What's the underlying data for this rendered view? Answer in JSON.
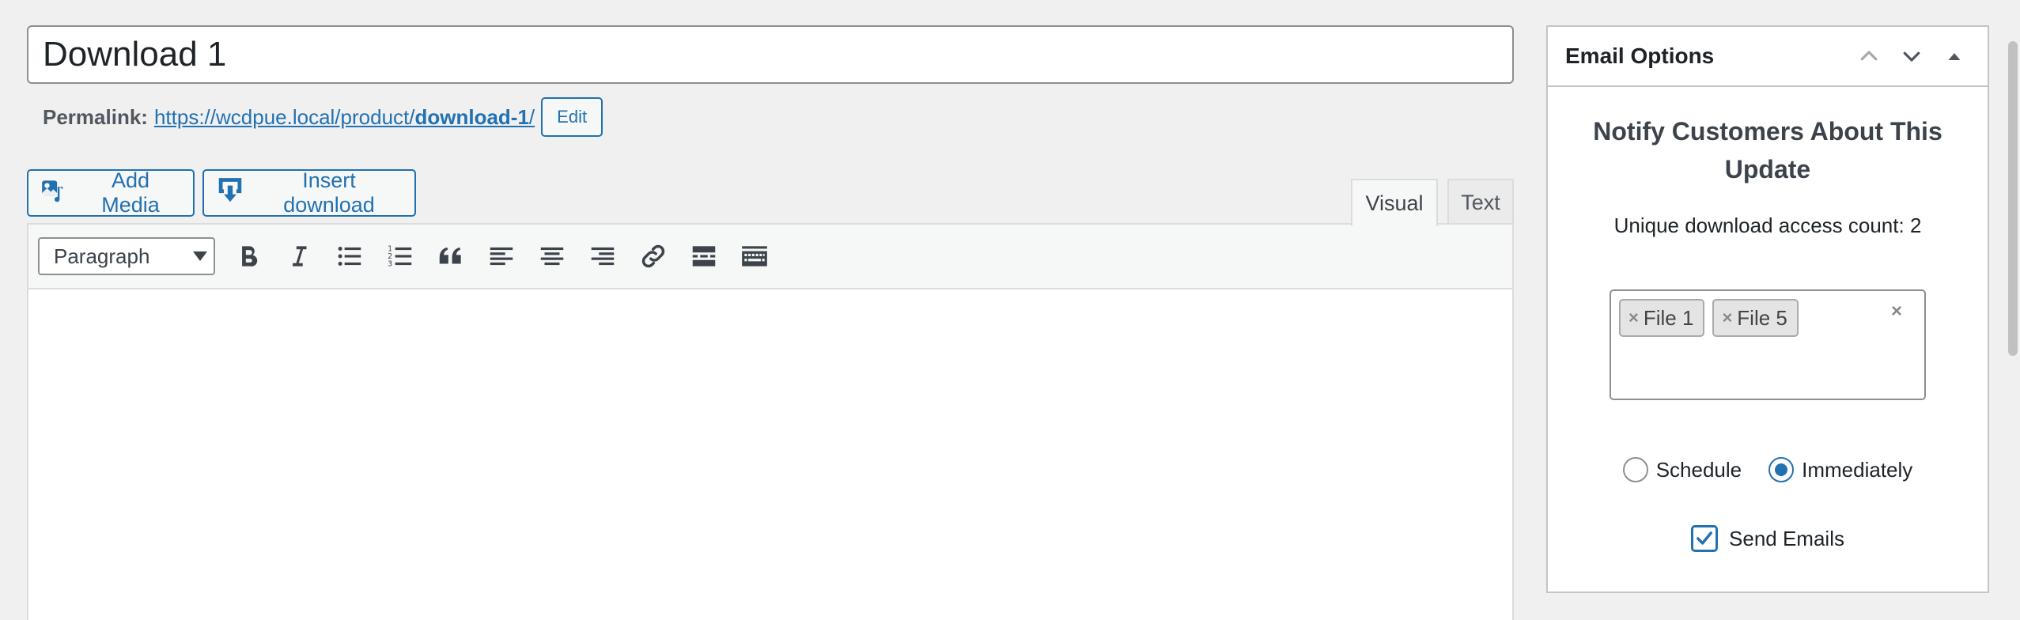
{
  "post": {
    "title_value": "Download 1",
    "permalink_label": "Permalink:",
    "permalink_base": "https://wcdpue.local/product/",
    "permalink_slug": "download-1",
    "permalink_trailing": "/",
    "edit_label": "Edit"
  },
  "media_buttons": {
    "add_media": "Add Media",
    "insert_download": "Insert download"
  },
  "editor": {
    "tabs": {
      "visual": "Visual",
      "text": "Text",
      "active": "visual"
    },
    "format_select": "Paragraph",
    "toolbar_icons": [
      "bold-icon",
      "italic-icon",
      "bulleted-list-icon",
      "numbered-list-icon",
      "blockquote-icon",
      "align-left-icon",
      "align-center-icon",
      "align-right-icon",
      "link-icon",
      "read-more-icon",
      "toolbar-toggle-icon"
    ],
    "content": ""
  },
  "email_options": {
    "title": "Email Options",
    "heading": "Notify Customers About This Update",
    "access_count": "Unique download access count: 2",
    "selected_files": [
      "File 1",
      "File 5"
    ],
    "chip_remove_glyph": "×",
    "clear_glyph": "×",
    "radio_schedule": "Schedule",
    "radio_immediately": "Immediately",
    "selected_timing": "Immediately",
    "send_emails_label": "Send Emails",
    "send_emails_checked": true
  },
  "colors": {
    "accent": "#2271b1",
    "background": "#f0f0f1",
    "border": "#c3c4c7"
  }
}
